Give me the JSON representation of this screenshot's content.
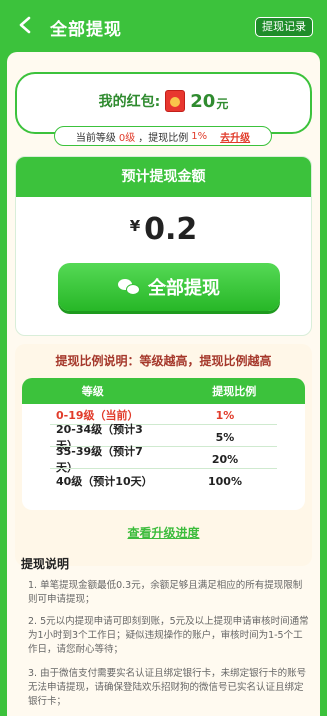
{
  "header": {
    "title": "全部提现",
    "record_button": "提现记录"
  },
  "redpack": {
    "label": "我的红包:",
    "amount": "20",
    "unit": "元"
  },
  "level": {
    "prefix": "当前等级",
    "level_value": "0级",
    "ratio_text": "，提现比例",
    "ratio_value": "1%",
    "upgrade_link": "去升级"
  },
  "withdraw": {
    "heading": "预计提现金额",
    "currency": "¥",
    "amount": "0.2",
    "button_label": "全部提现"
  },
  "ratio_info": {
    "title": "提现比例说明：等级越高，提现比例越高",
    "columns": [
      "等级",
      "提现比例"
    ],
    "rows": [
      {
        "level": "0-19级（当前）",
        "ratio": "1%"
      },
      {
        "level": "20-34级（预计3天）",
        "ratio": "5%"
      },
      {
        "level": "35-39级（预计7天）",
        "ratio": "20%"
      },
      {
        "level": "40级（预计10天）",
        "ratio": "100%"
      }
    ],
    "link": "查看升级进度"
  },
  "description": {
    "title": "提现说明",
    "items": [
      "1. 单笔提现金额最低0.3元，余额足够且满足相应的所有提现限制则可申请提现；",
      "2. 5元以内提现申请可即刻到账，5元及以上提现申请审核时间通常为1小时到3个工作日；疑似违规操作的账户，审核时间为1-5个工作日，请您耐心等待；",
      "3. 由于微信支付需要实名认证且绑定银行卡，未绑定银行卡的账号无法申请提现，请确保登陆欢乐招财狗的微信号已实名认证且绑定银行卡；"
    ]
  },
  "colors": {
    "primary_green": "#3cc23c",
    "accent_red": "#e13b2a"
  }
}
